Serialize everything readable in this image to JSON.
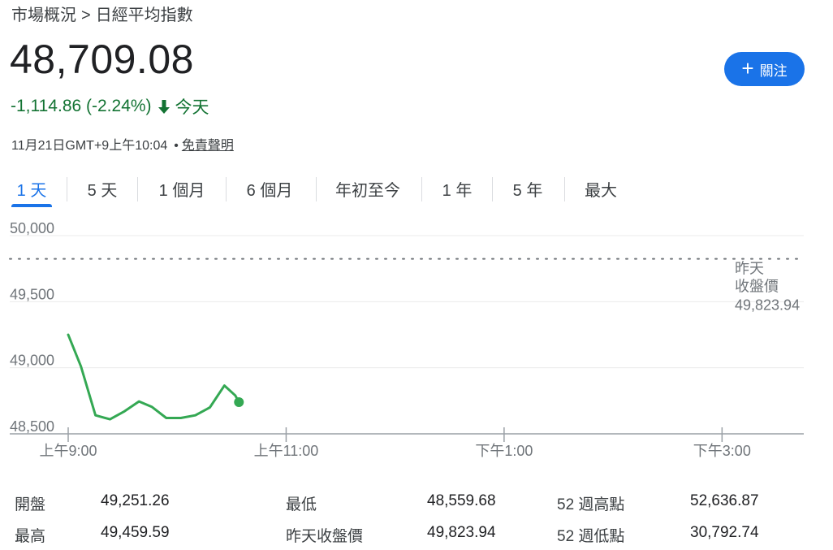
{
  "breadcrumb": {
    "parent": "市場概況",
    "separator": ">",
    "current": "日經平均指數"
  },
  "quote": {
    "price": "48,709.08",
    "change": "-1,114.86 (-2.24%)",
    "period": "今天",
    "direction": "down",
    "timestamp": "11月21日GMT+9上午10:04",
    "bullet": "•",
    "disclaimer": "免責聲明"
  },
  "follow_button": {
    "label": "關注",
    "icon": "plus-icon"
  },
  "tabs": [
    {
      "label": "1 天",
      "active": true
    },
    {
      "label": "5 天",
      "active": false
    },
    {
      "label": "1 個月",
      "active": false
    },
    {
      "label": "6 個月",
      "active": false
    },
    {
      "label": "年初至今",
      "active": false
    },
    {
      "label": "1 年",
      "active": false
    },
    {
      "label": "5 年",
      "active": false
    },
    {
      "label": "最大",
      "active": false
    }
  ],
  "colors": {
    "accent": "#1a73e8",
    "line": "#34a853",
    "negative": "#137333",
    "grid": "#ebebeb",
    "axis": "#70757a"
  },
  "chart_data": {
    "type": "line",
    "x_ticks": [
      {
        "label": "上午9:00",
        "minutes": 0
      },
      {
        "label": "上午11:00",
        "minutes": 120
      },
      {
        "label": "下午1:00",
        "minutes": 240
      },
      {
        "label": "下午3:00",
        "minutes": 360
      }
    ],
    "x_range_minutes": [
      0,
      405
    ],
    "y_ticks": [
      50000,
      49500,
      49000,
      48500
    ],
    "y_tick_labels": [
      "50,000",
      "49,500",
      "49,000",
      "48,500"
    ],
    "ylim": [
      48500,
      50000
    ],
    "reference": {
      "label_lines": [
        "昨天",
        "收盤價"
      ],
      "value_label": "49,823.94",
      "value": 49823.94
    },
    "series": [
      {
        "points": [
          {
            "t": 0,
            "v": 49250
          },
          {
            "t": 7,
            "v": 49010
          },
          {
            "t": 15,
            "v": 48640
          },
          {
            "t": 23,
            "v": 48610
          },
          {
            "t": 31,
            "v": 48670
          },
          {
            "t": 39,
            "v": 48745
          },
          {
            "t": 46,
            "v": 48705
          },
          {
            "t": 54,
            "v": 48620
          },
          {
            "t": 62,
            "v": 48620
          },
          {
            "t": 70,
            "v": 48640
          },
          {
            "t": 78,
            "v": 48700
          },
          {
            "t": 86,
            "v": 48865
          },
          {
            "t": 92,
            "v": 48790
          },
          {
            "t": 94,
            "v": 48740
          }
        ]
      }
    ]
  },
  "stats": [
    {
      "label": "開盤",
      "value": "49,251.26"
    },
    {
      "label": "最低",
      "value": "48,559.68"
    },
    {
      "label": "52 週高點",
      "value": "52,636.87"
    },
    {
      "label": "最高",
      "value": "49,459.59"
    },
    {
      "label": "昨天收盤價",
      "value": "49,823.94"
    },
    {
      "label": "52 週低點",
      "value": "30,792.74"
    }
  ]
}
